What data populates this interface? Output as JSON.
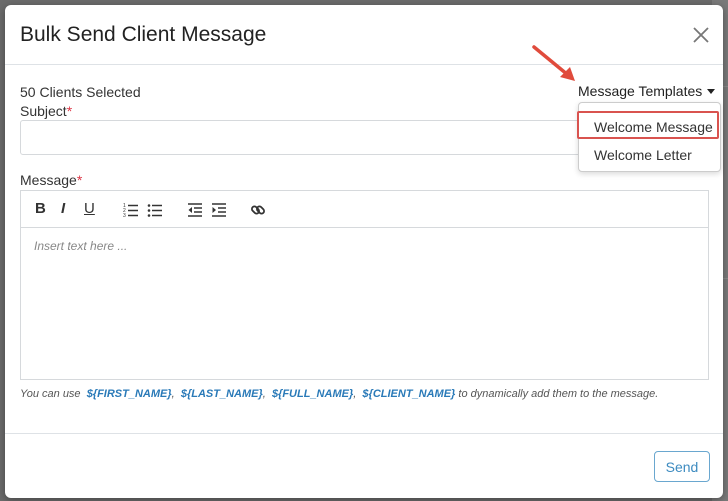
{
  "modal": {
    "title": "Bulk Send Client Message",
    "selected_count": "50 Clients Selected",
    "subject_label": "Subject",
    "required_mark": "*",
    "subject_value": "",
    "message_label": "Message",
    "editor_placeholder": "Insert text here ...",
    "send_label": "Send"
  },
  "templates": {
    "toggle_label": "Message Templates",
    "items": [
      "Welcome Message",
      "Welcome Letter"
    ],
    "highlighted": "Welcome Message"
  },
  "toolbar": {
    "bold": "B",
    "italic": "I",
    "underline": "U",
    "icons": [
      "bold-icon",
      "italic-icon",
      "underline-icon",
      "ordered-list-icon",
      "unordered-list-icon",
      "outdent-icon",
      "indent-icon",
      "link-icon"
    ]
  },
  "hint": {
    "prefix": "You can use",
    "vars": [
      "${FIRST_NAME}",
      "${LAST_NAME}",
      "${FULL_NAME}",
      "${CLIENT_NAME}"
    ],
    "sep": ",",
    "suffix": "to dynamically add them to the message."
  },
  "colors": {
    "accent": "#3d8bc0",
    "highlight": "#d9534f",
    "required": "#dc3545",
    "variable": "#2a7ab8"
  }
}
